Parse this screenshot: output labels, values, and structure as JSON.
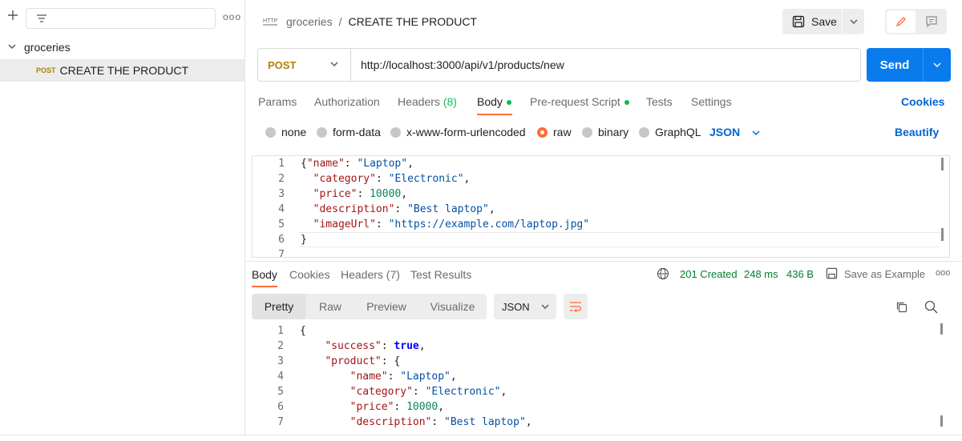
{
  "sidebar": {
    "more_label": "ooo",
    "folder": {
      "name": "groceries"
    },
    "request": {
      "method": "POST",
      "name": "CREATE THE PRODUCT"
    }
  },
  "header": {
    "breadcrumb_collection": "groceries",
    "breadcrumb_separator": "/",
    "breadcrumb_request": "CREATE THE PRODUCT",
    "save_label": "Save"
  },
  "request": {
    "method": "POST",
    "url": "http://localhost:3000/api/v1/products/new",
    "send_label": "Send"
  },
  "request_tabs": {
    "params": "Params",
    "authorization": "Authorization",
    "headers": "Headers",
    "headers_count": "(8)",
    "body": "Body",
    "prerequest": "Pre-request Script",
    "tests": "Tests",
    "settings": "Settings",
    "cookies": "Cookies"
  },
  "body_types": {
    "none": "none",
    "form_data": "form-data",
    "urlencoded": "x-www-form-urlencoded",
    "raw": "raw",
    "binary": "binary",
    "graphql": "GraphQL",
    "format": "JSON",
    "beautify": "Beautify"
  },
  "request_body": {
    "line_numbers": [
      "1",
      "2",
      "3",
      "4",
      "5",
      "6",
      "7"
    ],
    "brace_open": "{",
    "brace_close": "}",
    "name_key": "\"name\"",
    "name_value": "\"Laptop\"",
    "category_key": "\"category\"",
    "category_value": "\"Electronic\"",
    "price_key": "\"price\"",
    "price_value": "10000",
    "description_key": "\"description\"",
    "description_value": "\"Best laptop\"",
    "image_key": "\"imageUrl\"",
    "image_value": "\"https://example.com/laptop.jpg\""
  },
  "response_tabs": {
    "body": "Body",
    "cookies": "Cookies",
    "headers": "Headers (7)",
    "test_results": "Test Results",
    "status": "201 Created",
    "time": "248 ms",
    "size": "436 B",
    "save_example": "Save as Example",
    "more": "ooo"
  },
  "response_view": {
    "pretty": "Pretty",
    "raw": "Raw",
    "preview": "Preview",
    "visualize": "Visualize",
    "format": "JSON"
  },
  "response_body": {
    "line_numbers": [
      "1",
      "2",
      "3",
      "4",
      "5",
      "6",
      "7"
    ],
    "brace_open": "{",
    "success_key": "\"success\"",
    "success_value": "true",
    "product_key": "\"product\"",
    "name_key": "\"name\"",
    "name_value": "\"Laptop\"",
    "category_key": "\"category\"",
    "category_value": "\"Electronic\"",
    "price_key": "\"price\"",
    "price_value": "10000",
    "description_key": "\"description\"",
    "description_value": "\"Best laptop\""
  },
  "colors": {
    "accent": "#ff6c37",
    "send": "#097bed",
    "post_method": "#b37f00",
    "status_ok": "#007f31"
  }
}
